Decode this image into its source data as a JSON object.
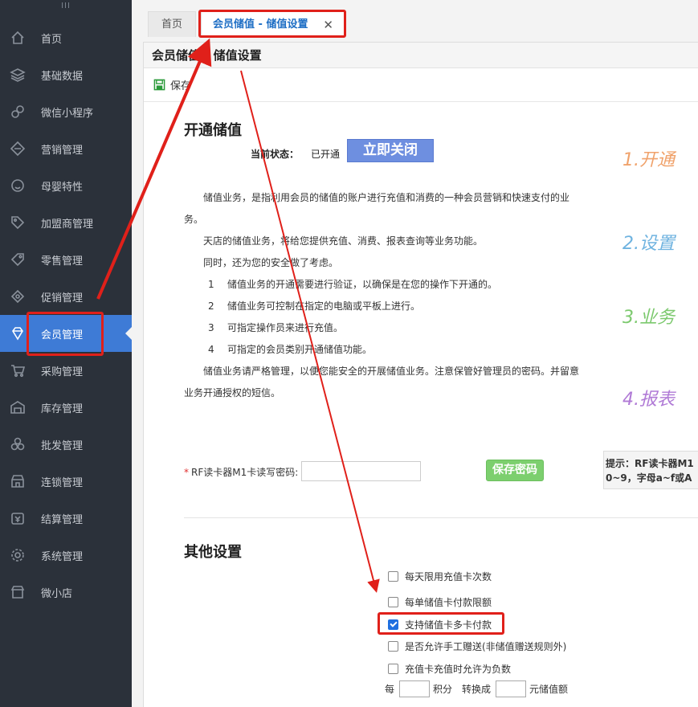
{
  "sidebar": {
    "grip": "III",
    "items": [
      {
        "label": "首页",
        "icon": "home-icon"
      },
      {
        "label": "基础数据",
        "icon": "layers-icon"
      },
      {
        "label": "微信小程序",
        "icon": "link-icon"
      },
      {
        "label": "营销管理",
        "icon": "diamond-icon"
      },
      {
        "label": "母婴特性",
        "icon": "smile-icon"
      },
      {
        "label": "加盟商管理",
        "icon": "tag-icon"
      },
      {
        "label": "零售管理",
        "icon": "price-tag-icon"
      },
      {
        "label": "促销管理",
        "icon": "bell-icon"
      },
      {
        "label": "会员管理",
        "icon": "gem-icon"
      },
      {
        "label": "采购管理",
        "icon": "cart-icon"
      },
      {
        "label": "库存管理",
        "icon": "warehouse-icon"
      },
      {
        "label": "批发管理",
        "icon": "boxes-icon"
      },
      {
        "label": "连锁管理",
        "icon": "store-icon"
      },
      {
        "label": "结算管理",
        "icon": "money-icon"
      },
      {
        "label": "系统管理",
        "icon": "gear-icon"
      },
      {
        "label": "微小店",
        "icon": "shop-icon"
      }
    ],
    "active_index": 8
  },
  "tabs": {
    "home": "首页",
    "current": "会员储值 - 储值设置",
    "close": "✕"
  },
  "panel": {
    "title": "会员储值 - 储值设置",
    "save_label": "保存"
  },
  "open_section": {
    "heading": "开通储值",
    "status_label": "当前状态：",
    "status_value": "已开通",
    "close_button": "立即关闭"
  },
  "description": {
    "p1": "储值业务，是指利用会员的储值的账户进行充值和消费的一种会员营销和快速支付的业务。",
    "p2": "天店的储值业务，将给您提供充值、消费、报表查询等业务功能。",
    "p3": "同时，还为您的安全做了考虑。",
    "items": [
      {
        "n": "1",
        "text": "储值业务的开通需要进行验证，以确保是在您的操作下开通的。"
      },
      {
        "n": "2",
        "text": "储值业务可控制在指定的电脑或平板上进行。"
      },
      {
        "n": "3",
        "text": "可指定操作员来进行充值。"
      },
      {
        "n": "4",
        "text": "可指定的会员类别开通储值功能。"
      }
    ],
    "p4": "储值业务请严格管理，以便您能安全的开展储值业务。注意保管好管理员的密码。并留意业务开通授权的短信。"
  },
  "steps": {
    "s1": "1.开通",
    "s2": "2.设置",
    "s3": "3.业务",
    "s4": "4.报表"
  },
  "rf": {
    "required_mark": "*",
    "label": "RF读卡器M1卡读写密码:",
    "value": "",
    "save_button": "保存密码",
    "hint_line1": "提示：RF读卡器M1",
    "hint_line2": "0~9，字母a~f或A"
  },
  "other": {
    "heading": "其他设置",
    "options": [
      {
        "label": "每天限用充值卡次数",
        "checked": false
      },
      {
        "label": "每单储值卡付款限额",
        "checked": false
      },
      {
        "label": "支持储值卡多卡付款",
        "checked": true
      },
      {
        "label": "是否允许手工赠送(非储值赠送规则外)",
        "checked": false
      },
      {
        "label": "充值卡充值时允许为负数",
        "checked": false
      }
    ],
    "points": {
      "prefix": "每",
      "unit1": "积分",
      "convert": "转换成",
      "unit2": "元储值额"
    }
  },
  "colors": {
    "sidebar_bg": "#2b313a",
    "active_bg": "#3e7bd6",
    "annotation_red": "#e0201a",
    "close_btn": "#6e8fe0",
    "save_pwd_btn": "#7ccf6e"
  }
}
